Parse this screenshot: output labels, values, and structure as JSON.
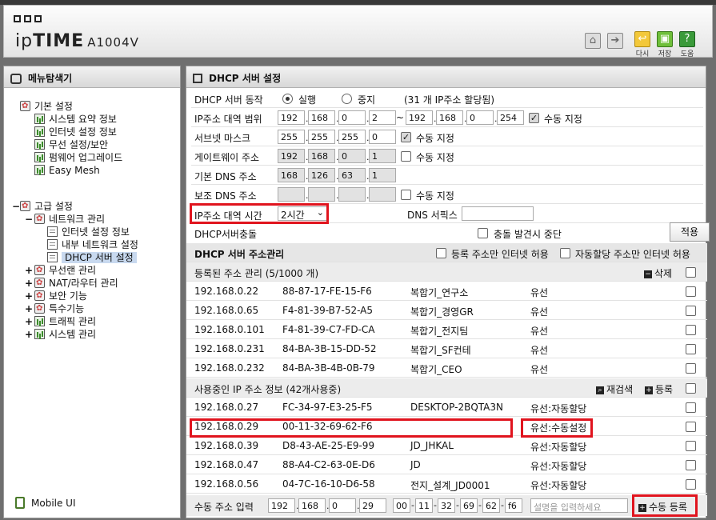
{
  "header": {
    "logo_prefix": "ip",
    "logo_brand": "TIME",
    "model": "A1004V",
    "tool_labels": {
      "reload": "다시",
      "save": "저장",
      "help": "도움"
    }
  },
  "sidebar": {
    "title": "메뉴탐색기",
    "basic": {
      "label": "기본 설정",
      "items": [
        "시스템 요약 정보",
        "인터넷 설정 정보",
        "무선 설정/보안",
        "펌웨어 업그레이드",
        "Easy Mesh"
      ]
    },
    "advanced": {
      "label": "고급 설정",
      "network": {
        "label": "네트워크 관리",
        "items": [
          "인터넷 설정 정보",
          "내부 네트워크 설정",
          "DHCP 서버 설정"
        ]
      },
      "groups": [
        "무선랜 관리",
        "NAT/라우터 관리",
        "보안 기능",
        "특수기능",
        "트래픽 관리",
        "시스템 관리"
      ]
    },
    "mobile": "Mobile UI"
  },
  "main": {
    "title": "DHCP 서버 설정",
    "server_action": {
      "label": "DHCP 서버 동작",
      "on": "실행",
      "off": "중지",
      "note": "(31 개 IP주소 할당됨)"
    },
    "ip_range": {
      "label": "IP주소 대역 범위",
      "start": [
        "192",
        "168",
        "0",
        "2"
      ],
      "tilde": "~",
      "end": [
        "192",
        "168",
        "0",
        "254"
      ],
      "manual": "수동 지정"
    },
    "subnet": {
      "label": "서브넷 마스크",
      "value": [
        "255",
        "255",
        "255",
        "0"
      ],
      "manual": "수동 지정"
    },
    "gateway": {
      "label": "게이트웨이 주소",
      "value": [
        "192",
        "168",
        "0",
        "1"
      ],
      "manual": "수동 지정"
    },
    "dns1": {
      "label": "기본 DNS 주소",
      "value": [
        "168",
        "126",
        "63",
        "1"
      ]
    },
    "dns2": {
      "label": "보조 DNS 주소",
      "value": [
        "",
        "",
        "",
        ""
      ],
      "manual": "수동 지정"
    },
    "lease": {
      "label": "IP주소 대역 시간",
      "value": "2시간 ",
      "dns_suffix_label": "DNS 서픽스"
    },
    "conflict": {
      "label": "DHCP서버충돌",
      "stop": "충돌 발견시 중단",
      "apply": "적용"
    },
    "address_mgmt": {
      "title": "DHCP 서버 주소관리",
      "only_registered": "등록 주소만 인터넷 허용",
      "auto_allowed": "자동할당 주소만 인터넷 허용"
    },
    "registered": {
      "title": "등록된 주소 관리 (5/1000 개)",
      "delete": "삭제",
      "rows": [
        {
          "ip": "192.168.0.22",
          "mac": "88-87-17-FE-15-F6",
          "name": "복합기_연구소",
          "type": "유선"
        },
        {
          "ip": "192.168.0.65",
          "mac": "F4-81-39-B7-52-A5",
          "name": "복합기_경영GR",
          "type": "유선"
        },
        {
          "ip": "192.168.0.101",
          "mac": "F4-81-39-C7-FD-CA",
          "name": "복합기_전지팀",
          "type": "유선"
        },
        {
          "ip": "192.168.0.231",
          "mac": "84-BA-3B-15-DD-52",
          "name": "복합기_SF컨테",
          "type": "유선"
        },
        {
          "ip": "192.168.0.232",
          "mac": "84-BA-3B-4B-0B-79",
          "name": "복합기_CEO",
          "type": "유선"
        }
      ]
    },
    "in_use": {
      "title": "사용중인 IP 주소 정보 (42개사용중)",
      "rescan": "재검색",
      "register": "등록",
      "rows": [
        {
          "ip": "192.168.0.27",
          "mac": "FC-34-97-E3-25-F5",
          "name": "DESKTOP-2BQTA3N",
          "type": "유선:자동할당"
        },
        {
          "ip": "192.168.0.29",
          "mac": "00-11-32-69-62-F6",
          "name": "",
          "type": "유선:수동설정"
        },
        {
          "ip": "192.168.0.39",
          "mac": "D8-43-AE-25-E9-99",
          "name": "JD_JHKAL",
          "type": "유선:자동할당"
        },
        {
          "ip": "192.168.0.47",
          "mac": "88-A4-C2-63-0E-D6",
          "name": "JD",
          "type": "유선:자동할당"
        },
        {
          "ip": "192.168.0.56",
          "mac": "04-7C-16-10-D6-58",
          "name": "전지_설계_JD0001",
          "type": "유선:자동할당"
        }
      ]
    },
    "manual_entry": {
      "label": "수동 주소 입력",
      "ip": [
        "192",
        "168",
        "0",
        "29"
      ],
      "mac": [
        "00",
        "11",
        "32",
        "69",
        "62",
        "f6"
      ],
      "desc_placeholder": "설명을 입력하세요",
      "register": "수동 등록"
    }
  }
}
